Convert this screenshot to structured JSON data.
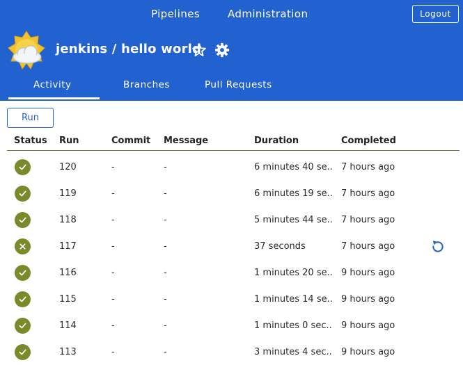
{
  "topnav": {
    "pipelines": "Pipelines",
    "administration": "Administration",
    "logout": "Logout"
  },
  "pipeline": {
    "title": "jenkins / hello world"
  },
  "tabs": [
    "Activity",
    "Branches",
    "Pull Requests"
  ],
  "active_tab": "Activity",
  "run_button": "Run",
  "table": {
    "headers": [
      "Status",
      "Run",
      "Commit",
      "Message",
      "Duration",
      "Completed"
    ],
    "rows": [
      {
        "status": "success",
        "run": "120",
        "commit": "-",
        "message": "-",
        "duration": "6 minutes 40 se...",
        "completed": "7 hours ago"
      },
      {
        "status": "success",
        "run": "119",
        "commit": "-",
        "message": "-",
        "duration": "6 minutes 19 se...",
        "completed": "7 hours ago"
      },
      {
        "status": "success",
        "run": "118",
        "commit": "-",
        "message": "-",
        "duration": "5 minutes 44 se...",
        "completed": "7 hours ago"
      },
      {
        "status": "aborted",
        "run": "117",
        "commit": "-",
        "message": "-",
        "duration": "37 seconds",
        "completed": "7 hours ago"
      },
      {
        "status": "success",
        "run": "116",
        "commit": "-",
        "message": "-",
        "duration": "1 minutes 20 se...",
        "completed": "9 hours ago"
      },
      {
        "status": "success",
        "run": "115",
        "commit": "-",
        "message": "-",
        "duration": "1 minutes 14 se...",
        "completed": "9 hours ago"
      },
      {
        "status": "success",
        "run": "114",
        "commit": "-",
        "message": "-",
        "duration": "1 minutes 0 sec...",
        "completed": "9 hours ago"
      },
      {
        "status": "success",
        "run": "113",
        "commit": "-",
        "message": "-",
        "duration": "3 minutes 4 sec...",
        "completed": "9 hours ago"
      }
    ]
  },
  "colors": {
    "header_bg": "#2162d0",
    "status_green": "#7a8a2a",
    "accent_blue": "#2162d0"
  },
  "icons": {
    "weather": "weather-cloudy-sun-icon",
    "favorite": "star-outline-icon",
    "settings": "gear-icon",
    "success": "check-icon",
    "aborted": "x-icon",
    "replay": "replay-icon"
  }
}
